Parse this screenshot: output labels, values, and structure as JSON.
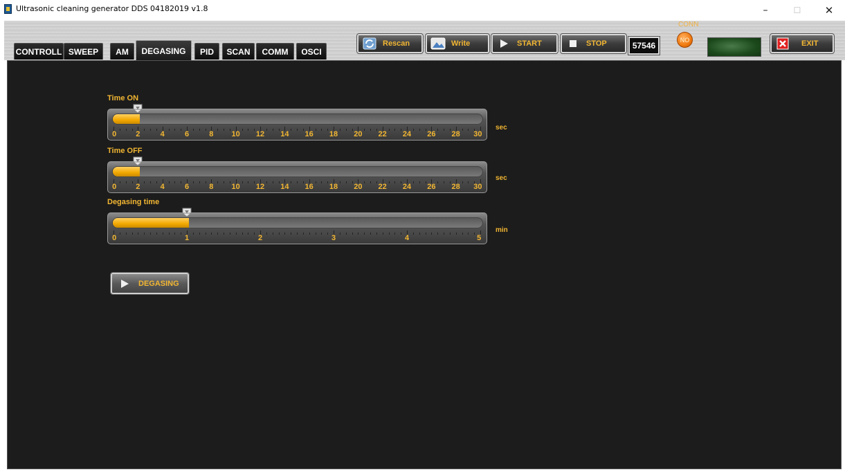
{
  "window": {
    "title": "Ultrasonic cleaning generator DDS 04182019 v1.8",
    "minimize": "–",
    "maximize": "☐",
    "close": "✕"
  },
  "tabs": [
    {
      "label": "CONTROLL",
      "active": false
    },
    {
      "label": "SWEEP",
      "active": false
    },
    {
      "label": "AM",
      "active": false
    },
    {
      "label": "DEGASING",
      "active": true
    },
    {
      "label": "PID",
      "active": false
    },
    {
      "label": "SCAN",
      "active": false
    },
    {
      "label": "COMM",
      "active": false
    },
    {
      "label": "OSCI",
      "active": false
    }
  ],
  "toolbar": {
    "rescan_label": "Rescan",
    "write_label": "Write",
    "start_label": "START",
    "stop_label": "STOP",
    "counter_value": "57546",
    "conn_label": "CONN",
    "conn_led_text": "NO",
    "exit_label": "EXIT"
  },
  "sliders": [
    {
      "label": "Time ON",
      "unit": "sec",
      "value": 2,
      "min": 0,
      "max": 30,
      "ticks": [
        "0",
        "2",
        "4",
        "6",
        "8",
        "10",
        "12",
        "14",
        "16",
        "18",
        "20",
        "22",
        "24",
        "26",
        "28",
        "30"
      ]
    },
    {
      "label": "Time OFF",
      "unit": "sec",
      "value": 2,
      "min": 0,
      "max": 30,
      "ticks": [
        "0",
        "2",
        "4",
        "6",
        "8",
        "10",
        "12",
        "14",
        "16",
        "18",
        "20",
        "22",
        "24",
        "26",
        "28",
        "30"
      ]
    },
    {
      "label": "Degasing time",
      "unit": "min",
      "value": 1,
      "min": 0,
      "max": 5,
      "ticks": [
        "0",
        "1",
        "2",
        "3",
        "4",
        "5"
      ]
    }
  ],
  "degasing_button_label": "DEGASING",
  "colors": {
    "accent": "#f2b632",
    "panel": "#1c1c1c",
    "led": "#f07a10"
  }
}
